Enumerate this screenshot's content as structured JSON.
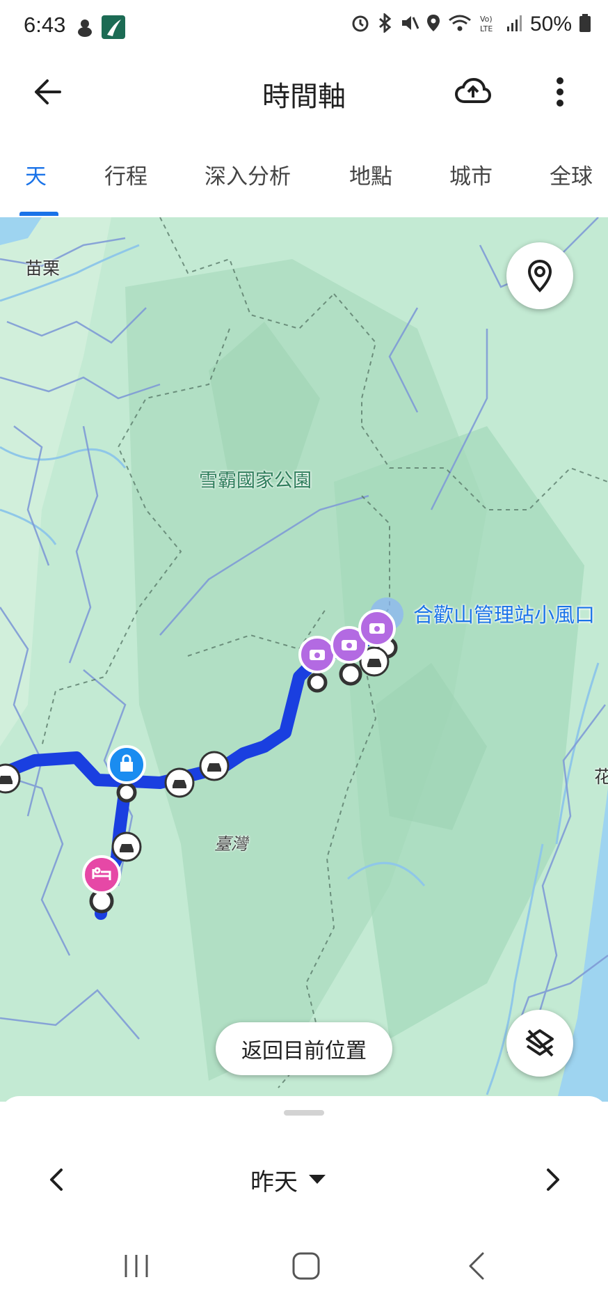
{
  "status_bar": {
    "time": "6:43",
    "battery": "50%",
    "icons": [
      "alarm-icon",
      "bluetooth-icon",
      "mute-icon",
      "location-icon",
      "wifi-icon",
      "volte-icon",
      "signal-icon",
      "battery-icon"
    ]
  },
  "app_bar": {
    "title": "時間軸",
    "back_icon": "arrow-back-icon",
    "upload_icon": "cloud-upload-icon",
    "more_icon": "more-vert-icon"
  },
  "tabs": [
    {
      "label": "天",
      "active": true
    },
    {
      "label": "行程",
      "active": false
    },
    {
      "label": "深入分析",
      "active": false
    },
    {
      "label": "地點",
      "active": false
    },
    {
      "label": "城市",
      "active": false
    },
    {
      "label": "全球",
      "active": false
    }
  ],
  "map": {
    "labels": {
      "miaoli": "苗栗",
      "park": "雪霸國家公園",
      "taiwan": "臺灣",
      "poi": "合歡山管理站小風口",
      "east_edge": "花"
    },
    "colors": {
      "route": "#1a3fe0",
      "photo_marker": "#b36ae2",
      "hotel_marker": "#e648a6",
      "shop_marker": "#1a8cf0",
      "water": "#9ed4f0"
    },
    "return_button": "返回目前位置"
  },
  "bottom_sheet": {
    "day_label": "昨天",
    "prev_icon": "chevron-left-icon",
    "next_icon": "chevron-right-icon",
    "dropdown_icon": "caret-down-icon"
  },
  "nav_bar": {
    "icons": [
      "recent-apps-icon",
      "home-icon",
      "back-nav-icon"
    ]
  }
}
